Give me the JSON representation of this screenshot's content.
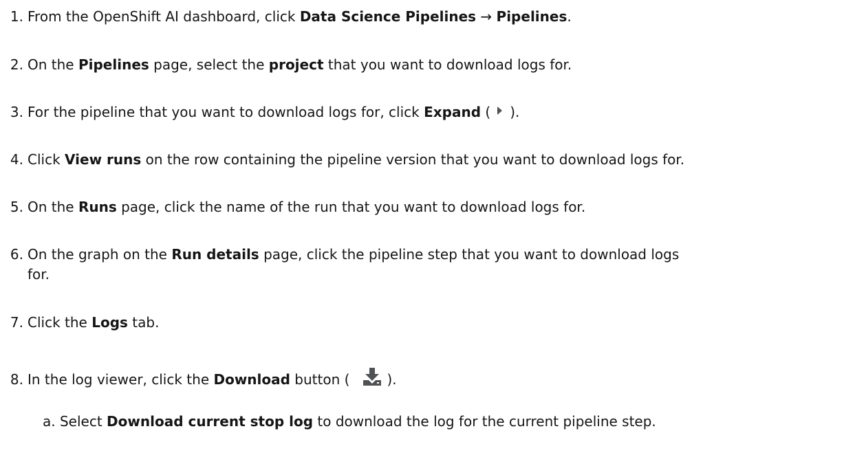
{
  "steps": [
    {
      "num": "1.",
      "t1": "From the OpenShift AI dashboard, click ",
      "b1": "Data Science Pipelines",
      "t2": " → ",
      "b2": "Pipelines",
      "t3": "."
    },
    {
      "num": "2.",
      "t1": "On the ",
      "b1": "Pipelines",
      "t2": " page, select the ",
      "b2": "project",
      "t3": " that you want to download logs for."
    },
    {
      "num": "3.",
      "t1": "For the pipeline that you want to download logs for, click ",
      "b1": "Expand",
      "t2": " (",
      "icon": "chevron-right-icon",
      "t3": ")."
    },
    {
      "num": "4.",
      "t1": "Click ",
      "b1": "View runs",
      "t2": " on the row containing the pipeline version that you want to download logs for."
    },
    {
      "num": "5.",
      "t1": "On the ",
      "b1": "Runs",
      "t2": " page, click the name of the run that you want to download logs for."
    },
    {
      "num": "6.",
      "t1": "On the graph on the ",
      "b1": "Run details",
      "t2": " page, click the pipeline step that you want to download logs",
      "cont": "for."
    },
    {
      "num": "7.",
      "t1": "Click the ",
      "b1": "Logs",
      "t2": " tab."
    },
    {
      "num": "8.",
      "t1": "In the log viewer, click the ",
      "b1": "Download",
      "t2": " button (",
      "icon": "download-icon",
      "t3": ")."
    }
  ],
  "substeps": [
    {
      "letter": "a.",
      "t1": "Select ",
      "b1": "Download current stop log",
      "t2": " to download the log for the current pipeline step."
    }
  ],
  "colors": {
    "text": "#151515",
    "icon": "#4f5255"
  }
}
